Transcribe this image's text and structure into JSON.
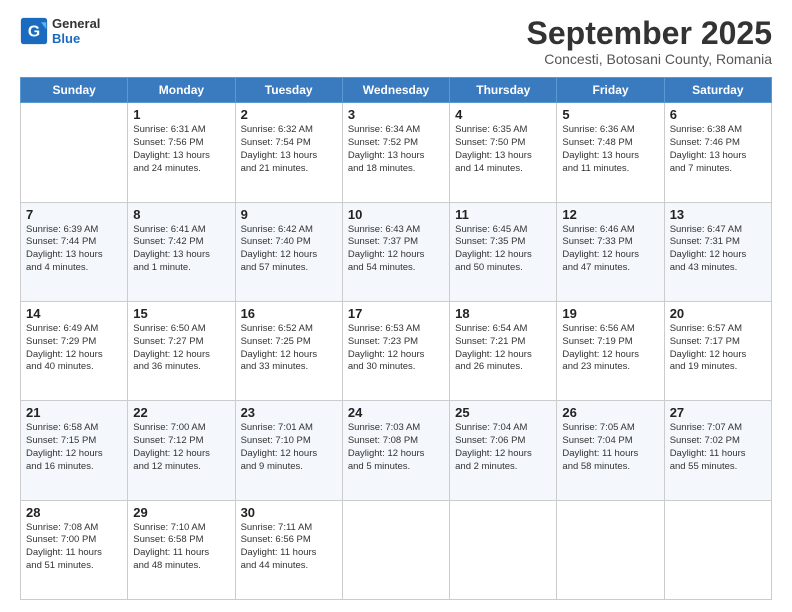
{
  "header": {
    "logo_general": "General",
    "logo_blue": "Blue",
    "month_title": "September 2025",
    "subtitle": "Concesti, Botosani County, Romania"
  },
  "days_of_week": [
    "Sunday",
    "Monday",
    "Tuesday",
    "Wednesday",
    "Thursday",
    "Friday",
    "Saturday"
  ],
  "weeks": [
    [
      {
        "day": "",
        "info": ""
      },
      {
        "day": "1",
        "info": "Sunrise: 6:31 AM\nSunset: 7:56 PM\nDaylight: 13 hours\nand 24 minutes."
      },
      {
        "day": "2",
        "info": "Sunrise: 6:32 AM\nSunset: 7:54 PM\nDaylight: 13 hours\nand 21 minutes."
      },
      {
        "day": "3",
        "info": "Sunrise: 6:34 AM\nSunset: 7:52 PM\nDaylight: 13 hours\nand 18 minutes."
      },
      {
        "day": "4",
        "info": "Sunrise: 6:35 AM\nSunset: 7:50 PM\nDaylight: 13 hours\nand 14 minutes."
      },
      {
        "day": "5",
        "info": "Sunrise: 6:36 AM\nSunset: 7:48 PM\nDaylight: 13 hours\nand 11 minutes."
      },
      {
        "day": "6",
        "info": "Sunrise: 6:38 AM\nSunset: 7:46 PM\nDaylight: 13 hours\nand 7 minutes."
      }
    ],
    [
      {
        "day": "7",
        "info": "Sunrise: 6:39 AM\nSunset: 7:44 PM\nDaylight: 13 hours\nand 4 minutes."
      },
      {
        "day": "8",
        "info": "Sunrise: 6:41 AM\nSunset: 7:42 PM\nDaylight: 13 hours\nand 1 minute."
      },
      {
        "day": "9",
        "info": "Sunrise: 6:42 AM\nSunset: 7:40 PM\nDaylight: 12 hours\nand 57 minutes."
      },
      {
        "day": "10",
        "info": "Sunrise: 6:43 AM\nSunset: 7:37 PM\nDaylight: 12 hours\nand 54 minutes."
      },
      {
        "day": "11",
        "info": "Sunrise: 6:45 AM\nSunset: 7:35 PM\nDaylight: 12 hours\nand 50 minutes."
      },
      {
        "day": "12",
        "info": "Sunrise: 6:46 AM\nSunset: 7:33 PM\nDaylight: 12 hours\nand 47 minutes."
      },
      {
        "day": "13",
        "info": "Sunrise: 6:47 AM\nSunset: 7:31 PM\nDaylight: 12 hours\nand 43 minutes."
      }
    ],
    [
      {
        "day": "14",
        "info": "Sunrise: 6:49 AM\nSunset: 7:29 PM\nDaylight: 12 hours\nand 40 minutes."
      },
      {
        "day": "15",
        "info": "Sunrise: 6:50 AM\nSunset: 7:27 PM\nDaylight: 12 hours\nand 36 minutes."
      },
      {
        "day": "16",
        "info": "Sunrise: 6:52 AM\nSunset: 7:25 PM\nDaylight: 12 hours\nand 33 minutes."
      },
      {
        "day": "17",
        "info": "Sunrise: 6:53 AM\nSunset: 7:23 PM\nDaylight: 12 hours\nand 30 minutes."
      },
      {
        "day": "18",
        "info": "Sunrise: 6:54 AM\nSunset: 7:21 PM\nDaylight: 12 hours\nand 26 minutes."
      },
      {
        "day": "19",
        "info": "Sunrise: 6:56 AM\nSunset: 7:19 PM\nDaylight: 12 hours\nand 23 minutes."
      },
      {
        "day": "20",
        "info": "Sunrise: 6:57 AM\nSunset: 7:17 PM\nDaylight: 12 hours\nand 19 minutes."
      }
    ],
    [
      {
        "day": "21",
        "info": "Sunrise: 6:58 AM\nSunset: 7:15 PM\nDaylight: 12 hours\nand 16 minutes."
      },
      {
        "day": "22",
        "info": "Sunrise: 7:00 AM\nSunset: 7:12 PM\nDaylight: 12 hours\nand 12 minutes."
      },
      {
        "day": "23",
        "info": "Sunrise: 7:01 AM\nSunset: 7:10 PM\nDaylight: 12 hours\nand 9 minutes."
      },
      {
        "day": "24",
        "info": "Sunrise: 7:03 AM\nSunset: 7:08 PM\nDaylight: 12 hours\nand 5 minutes."
      },
      {
        "day": "25",
        "info": "Sunrise: 7:04 AM\nSunset: 7:06 PM\nDaylight: 12 hours\nand 2 minutes."
      },
      {
        "day": "26",
        "info": "Sunrise: 7:05 AM\nSunset: 7:04 PM\nDaylight: 11 hours\nand 58 minutes."
      },
      {
        "day": "27",
        "info": "Sunrise: 7:07 AM\nSunset: 7:02 PM\nDaylight: 11 hours\nand 55 minutes."
      }
    ],
    [
      {
        "day": "28",
        "info": "Sunrise: 7:08 AM\nSunset: 7:00 PM\nDaylight: 11 hours\nand 51 minutes."
      },
      {
        "day": "29",
        "info": "Sunrise: 7:10 AM\nSunset: 6:58 PM\nDaylight: 11 hours\nand 48 minutes."
      },
      {
        "day": "30",
        "info": "Sunrise: 7:11 AM\nSunset: 6:56 PM\nDaylight: 11 hours\nand 44 minutes."
      },
      {
        "day": "",
        "info": ""
      },
      {
        "day": "",
        "info": ""
      },
      {
        "day": "",
        "info": ""
      },
      {
        "day": "",
        "info": ""
      }
    ]
  ]
}
